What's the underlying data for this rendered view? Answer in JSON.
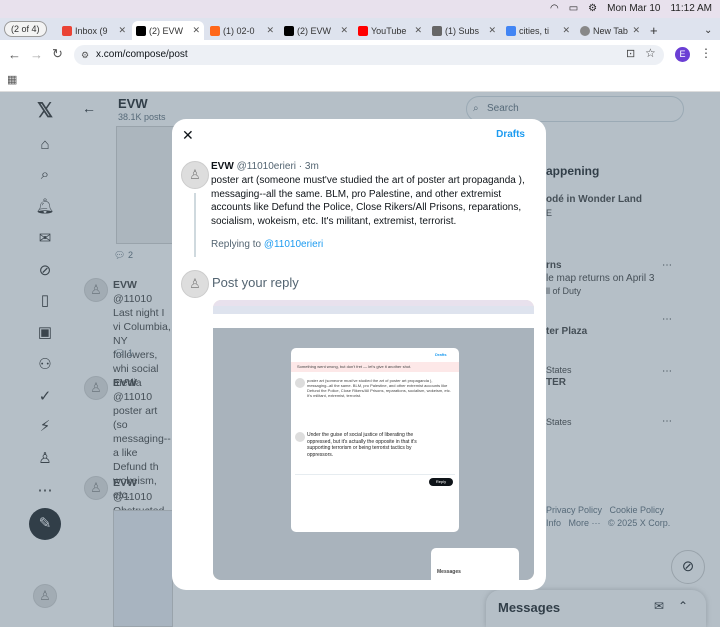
{
  "menubar": {
    "date": "Mon Mar 10",
    "time": "11:12 AM"
  },
  "tabs": [
    {
      "label": "(2 of 4)"
    },
    {
      "label": "Inbox (9",
      "color": "#ea4335"
    },
    {
      "label": "(2) EVW",
      "color": "#000000"
    },
    {
      "label": "(1) 02-0",
      "color": "#ff6719"
    },
    {
      "label": "(2) EVW",
      "color": "#000000"
    },
    {
      "label": "YouTube",
      "color": "#ff0000"
    },
    {
      "label": "(1) Subs",
      "color": "#666666"
    },
    {
      "label": "cities, ti",
      "color": "#4285f4"
    },
    {
      "label": "New Tab",
      "color": "#888888"
    }
  ],
  "address": {
    "url": "x.com/compose/post",
    "profile": "E"
  },
  "profile": {
    "name": "EVW",
    "posts": "38.1K posts"
  },
  "feed": [
    {
      "name": "EVW",
      "handle": "@11010",
      "reply_count": "2"
    },
    {
      "name": "EVW",
      "handle": "@11010",
      "text": "Last night I vi Columbia, NY followers, whi social media",
      "reply_count": "1"
    },
    {
      "name": "EVW",
      "handle": "@11010",
      "text": "poster art (so messaging--a like Defund th wokeism, etc."
    },
    {
      "name": "EVW",
      "handle": "@11010",
      "text": "Obstructed fr"
    }
  ],
  "search": {
    "placeholder": "Search"
  },
  "trends": {
    "heading": "appening",
    "items": [
      {
        "title": "odé in Wonder Land",
        "sub": "E"
      },
      {
        "title": "rns",
        "sub": "le map returns on April 3",
        "sub2": "ll of Duty"
      },
      {
        "title": "ter Plaza",
        "sub": ""
      },
      {
        "title": "States",
        "sub": "TER"
      },
      {
        "title": "States",
        "sub": ""
      }
    ]
  },
  "footer": {
    "links": [
      "Privacy Policy",
      "Cookie Policy",
      "Info",
      "More ···",
      "© 2025 X Corp."
    ]
  },
  "messages": {
    "label": "Messages"
  },
  "modal": {
    "drafts": "Drafts",
    "name": "EVW",
    "handle": "@11010erieri",
    "time": "· 3m",
    "body": "poster art (someone must've studied the art of poster art propaganda ), messaging--all the same. BLM, pro Palestine, and other extremist accounts like Defund the Police, Close Rikers/All Prisons, reparations, socialism, wokeism, etc. It's militant, extremist, terrorist.",
    "replying_prefix": "Replying to",
    "replying_handle": "@11010erieri",
    "placeholder": "Post your reply",
    "screenshot": {
      "banner": "Something went wrong, but don't fret — let's give it another shot.",
      "reply_text": "Under the guise of social justice of liberating the oppressed, but it's actually the opposite in that it's supporting terrorism or being terrorist tactics by oppressors.",
      "reply_button": "Reply",
      "drafts": "Drafts"
    }
  }
}
